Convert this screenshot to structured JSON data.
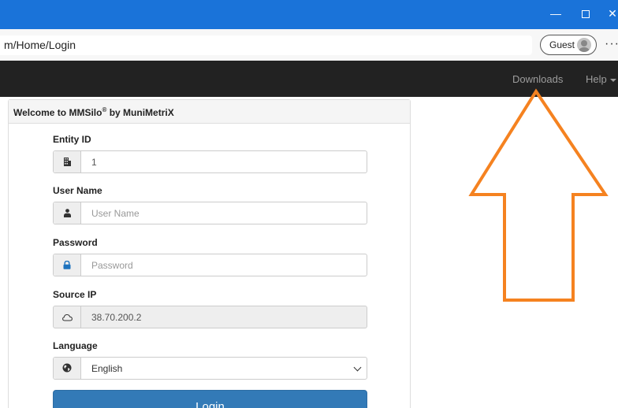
{
  "window": {
    "minimize_glyph": "—",
    "close_glyph": "✕"
  },
  "address_bar": {
    "url": "m/Home/Login",
    "profile_label": "Guest",
    "more_glyph": "···"
  },
  "navbar": {
    "downloads_label": "Downloads",
    "help_label": "Help"
  },
  "panel": {
    "heading_prefix": "Welcome to MMSilo",
    "heading_sup": "®",
    "heading_suffix": " by MuniMetriX"
  },
  "form": {
    "entity_id": {
      "label": "Entity ID",
      "value": "1",
      "icon": "building-icon"
    },
    "user_name": {
      "label": "User Name",
      "placeholder": "User Name",
      "icon": "user-icon"
    },
    "password": {
      "label": "Password",
      "placeholder": "Password",
      "icon": "lock-icon"
    },
    "source_ip": {
      "label": "Source IP",
      "value": "38.70.200.2",
      "icon": "cloud-icon"
    },
    "language": {
      "label": "Language",
      "selected": "English",
      "icon": "globe-icon"
    },
    "login_label": "Login"
  },
  "annotation": {
    "arrow_color": "#f58220",
    "arrow_icon": "up-arrow-annotation"
  },
  "colors": {
    "titlebar": "#1a73d9",
    "navbar": "#222222",
    "primary_button": "#337ab7"
  }
}
